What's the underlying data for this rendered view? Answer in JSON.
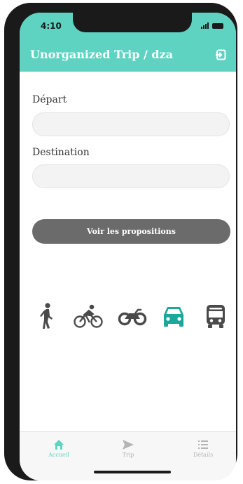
{
  "status": {
    "time": "4:10"
  },
  "header": {
    "title": "Unorganized Trip / dza"
  },
  "form": {
    "depart_label": "Départ",
    "depart_value": "",
    "destination_label": "Destination",
    "destination_value": "",
    "submit_label": "Voir les propositions"
  },
  "modes": [
    {
      "name": "walk",
      "icon": "walk-icon",
      "selected": false
    },
    {
      "name": "bike",
      "icon": "bicycle-icon",
      "selected": false
    },
    {
      "name": "motorbike",
      "icon": "motorcycle-icon",
      "selected": false
    },
    {
      "name": "car",
      "icon": "car-icon",
      "selected": true
    },
    {
      "name": "bus",
      "icon": "bus-icon",
      "selected": false
    }
  ],
  "tabs": {
    "home": {
      "label": "Accueil",
      "active": true,
      "icon": "home-icon"
    },
    "trip": {
      "label": "Trip",
      "active": false,
      "icon": "send-icon"
    },
    "details": {
      "label": "Détails",
      "active": false,
      "icon": "list-icon"
    }
  },
  "colors": {
    "accent": "#5fd3c1",
    "selected": "#1aa89b",
    "icon": "#4a4a4a",
    "inactive_tab": "#b5b5b5"
  }
}
